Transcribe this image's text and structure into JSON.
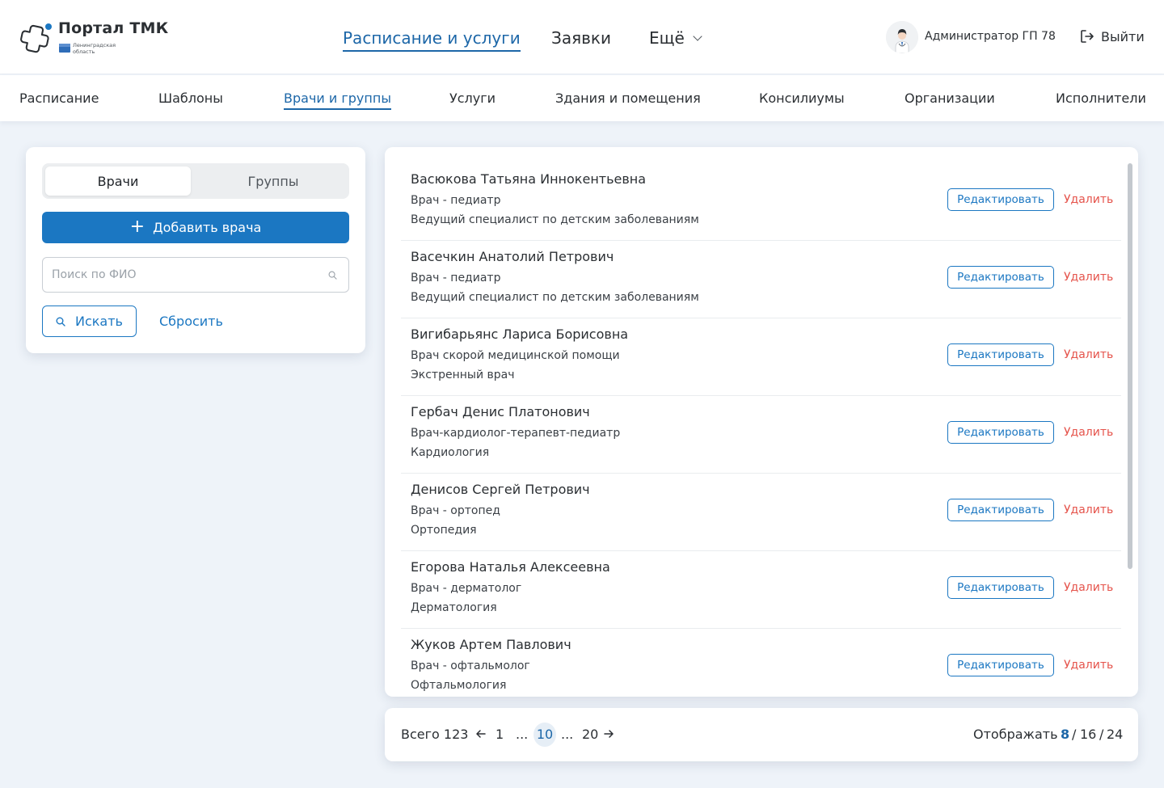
{
  "brand": {
    "title": "Портал ТМК",
    "subtitle": "Ленинградская область"
  },
  "main_nav": {
    "items": [
      {
        "label": "Расписание и услуги",
        "active": true
      },
      {
        "label": "Заявки",
        "active": false
      },
      {
        "label": "Ещё",
        "active": false
      }
    ]
  },
  "user": {
    "name": "Администратор ГП 78",
    "logout_label": "Выйти"
  },
  "sub_nav": {
    "items": [
      {
        "label": "Расписание",
        "active": false
      },
      {
        "label": "Шаблоны",
        "active": false
      },
      {
        "label": "Врачи и группы",
        "active": true
      },
      {
        "label": "Услуги",
        "active": false
      },
      {
        "label": "Здания и помещения",
        "active": false
      },
      {
        "label": "Консилиумы",
        "active": false
      },
      {
        "label": "Организации",
        "active": false
      },
      {
        "label": "Исполнители",
        "active": false
      }
    ]
  },
  "filter": {
    "tabs": [
      {
        "label": "Врачи",
        "active": true
      },
      {
        "label": "Группы",
        "active": false
      }
    ],
    "add_button": "Добавить врача",
    "search_placeholder": "Поиск по ФИО",
    "search_value": "",
    "find_button": "Искать",
    "reset_link": "Сбросить"
  },
  "doctors": {
    "edit_label": "Редактировать",
    "delete_label": "Удалить",
    "items": [
      {
        "name": "Васюкова Татьяна Иннокентьевна",
        "position": "Врач - педиатр",
        "specialty": "Ведущий специалист по детским заболеваниям"
      },
      {
        "name": "Васечкин Анатолий Петрович",
        "position": "Врач - педиатр",
        "specialty": "Ведущий специалист по детским заболеваниям"
      },
      {
        "name": "Вигибарьянс Лариса Борисовна",
        "position": "Врач скорой медицинской помощи",
        "specialty": "Экстренный врач"
      },
      {
        "name": "Гербач Денис Платонович",
        "position": "Врач-кардиолог-терапевт-педиатр",
        "specialty": "Кардиология"
      },
      {
        "name": "Денисов Сергей Петрович",
        "position": "Врач - ортопед",
        "specialty": "Ортопедия"
      },
      {
        "name": "Егорова Наталья Алексеевна",
        "position": "Врач - дерматолог",
        "specialty": "Дерматология"
      },
      {
        "name": "Жуков Артем Павлович",
        "position": "Врач - офтальмолог",
        "specialty": "Офтальмология"
      }
    ]
  },
  "pagination": {
    "total_label": "Всего 123",
    "pages": [
      "1",
      "...",
      "10",
      "...",
      "20"
    ],
    "current_page": "10",
    "show_label": "Отображать",
    "page_sizes": [
      "8",
      "16",
      "24"
    ],
    "current_size": "8",
    "separator": "/"
  },
  "colors": {
    "accent": "#1b77c2",
    "active_nav": "#1d67a8",
    "danger": "#e5534b",
    "page_bg": "#eef3f9"
  }
}
